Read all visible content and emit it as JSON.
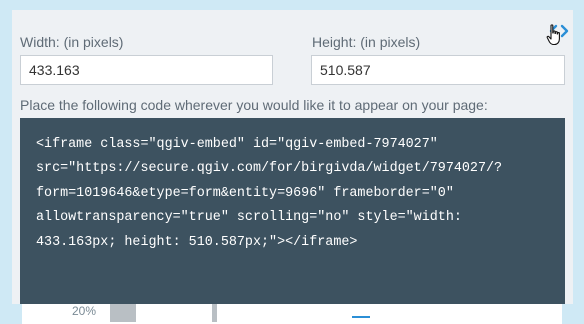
{
  "embed_dialog": {
    "width_label": "Width: (in pixels)",
    "width_value": "433.163",
    "height_label": "Height: (in pixels)",
    "height_value": "510.587",
    "instruction": "Place the following code wherever you would like it to appear on your page:",
    "code": "<iframe class=\"qgiv-embed\" id=\"qgiv-embed-7974027\"\nsrc=\"https://secure.qgiv.com/for/birgivda/widget/7974027/?\nform=1019646&etype=form&entity=9696\" frameborder=\"0\"\nallowtransparency=\"true\" scrolling=\"no\" style=\"width:\n433.163px; height: 510.587px;\"></iframe>",
    "embed_icon": "code-brackets-icon",
    "cursor_icon": "hand-pointer-icon"
  },
  "background": {
    "partial_text": "20%"
  },
  "colors": {
    "accent": "#2b8fd6",
    "code_background": "#3d5260",
    "panel_background": "#eef1f4",
    "page_background": "#cfe9f5"
  }
}
